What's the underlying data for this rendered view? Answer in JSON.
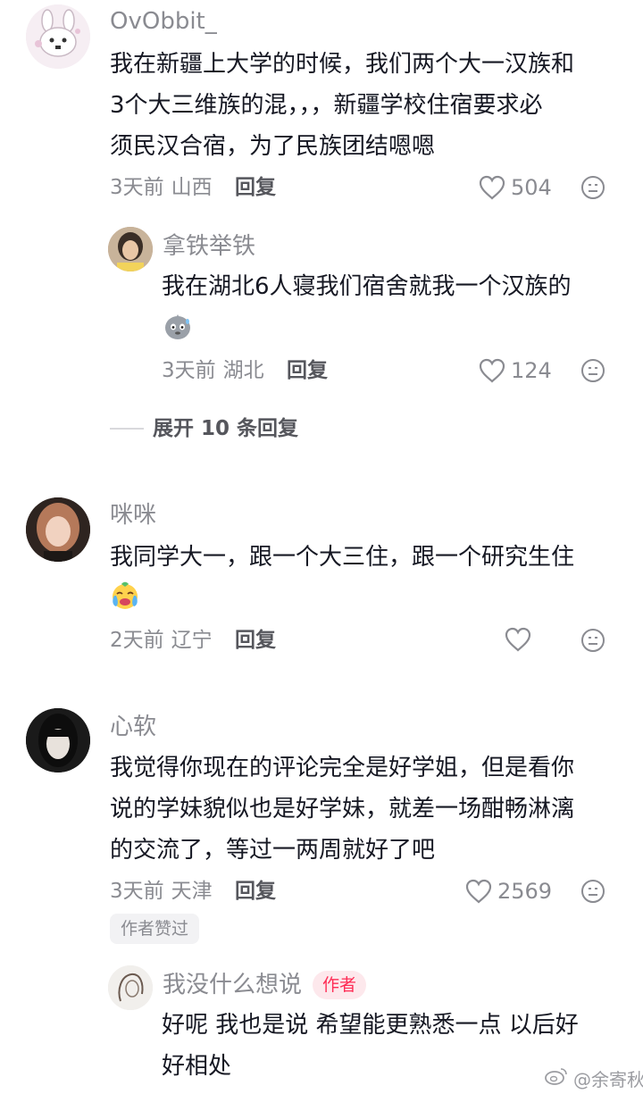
{
  "comments": [
    {
      "username": "OvObbit_",
      "text_lines": [
        "我在新疆上大学的时候，我们两个大一汉族和",
        "3个大三维族的混，，，新疆学校住宿要求必",
        "须民汉合宿，为了民族团结嗯嗯"
      ],
      "time": "3天前",
      "location": "山西",
      "reply_label": "回复",
      "likes": "504",
      "replies": [
        {
          "username": "拿铁举铁",
          "text_lines": [
            "我在湖北6人寝我们宿舍就我一个汉族的"
          ],
          "emoji": "sweat-face",
          "time": "3天前",
          "location": "湖北",
          "reply_label": "回复",
          "likes": "124"
        }
      ],
      "expand_label": "展开 10 条回复"
    },
    {
      "username": "咪咪",
      "text_lines": [
        "我同学大一，跟一个大三住，跟一个研究生住"
      ],
      "emoji": "crying-face",
      "time": "2天前",
      "location": "辽宁",
      "reply_label": "回复",
      "likes": ""
    },
    {
      "username": "心软",
      "text_lines": [
        "我觉得你现在的评论完全是好学姐，但是看你",
        "说的学妹貌似也是好学妹，就差一场酣畅淋漓",
        "的交流了，等过一两周就好了吧"
      ],
      "time": "3天前",
      "location": "天津",
      "reply_label": "回复",
      "likes": "2569",
      "badge": "作者赞过",
      "replies": [
        {
          "username": "我没什么想说",
          "author_tag": "作者",
          "text_lines": [
            "好呢 我也是说 希望能更熟悉一点 以后好",
            "好相处"
          ]
        }
      ]
    }
  ],
  "watermark": "@余寄秋",
  "colors": {
    "text": "#161823",
    "secondary": "#8a8b91",
    "accent": "#fe2c55",
    "badge_bg": "#f2f2f4"
  },
  "icons": [
    "heart-outline-icon",
    "dislike-face-icon",
    "weibo-logo-icon"
  ]
}
